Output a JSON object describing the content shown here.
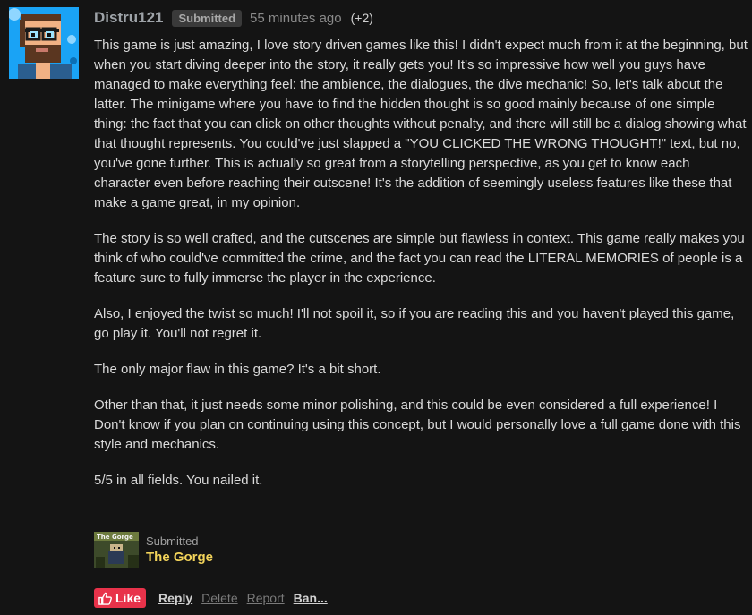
{
  "author": {
    "username": "Distru121",
    "badge": "Submitted",
    "timestamp": "55 minutes ago",
    "votes": "(+2)",
    "avatar_icon": "pixel-art-avatar-icon"
  },
  "comment": {
    "paragraphs": [
      "This game is just amazing, I love story driven games like this! I didn't expect much from it at the beginning, but when you start diving deeper into the story, it really gets you! It's so impressive how well you guys have managed to make everything feel: the ambience, the dialogues, the dive mechanic! So, let's talk about the latter. The minigame where you have to find the hidden thought is so good mainly because of one simple thing: the fact that you can click on other thoughts without penalty, and there will still be a dialog showing what that thought represents. You could've just slapped a \"YOU CLICKED THE WRONG THOUGHT!\" text, but no, you've gone further. This is actually so great from a storytelling perspective, as you get to know each character even before reaching their cutscene! It's the addition of seemingly useless features like these that make a game great, in my opinion.",
      "The story is so well crafted, and the cutscenes are simple but flawless in context. This game really makes you think of who could've committed the crime, and the fact you can read the LITERAL MEMORIES of people is a feature sure to fully immerse the player in the experience.",
      "Also, I enjoyed the twist so much! I'll not spoil it, so if you are reading this and you haven't played this game, go play it. You'll not regret it.",
      "The only major flaw in this game? It's a bit short.",
      "Other than that, it just needs some minor polishing, and this could be even considered a full experience! I Don't know if you plan on continuing using this concept, but I would personally love a full game done with this style and mechanics.",
      "5/5 in all fields. You nailed it."
    ]
  },
  "game": {
    "kicker": "Submitted",
    "title": "The Gorge",
    "thumb_text": "The Gorge"
  },
  "actions": {
    "like_label": "Like",
    "reply_label": "Reply",
    "delete_label": "Delete",
    "report_label": "Report",
    "ban_label": "Ban..."
  },
  "colors": {
    "background": "#141414",
    "like_button": "#e8324a",
    "game_title": "#f2d35a",
    "badge_bg": "#3a3a3a"
  }
}
